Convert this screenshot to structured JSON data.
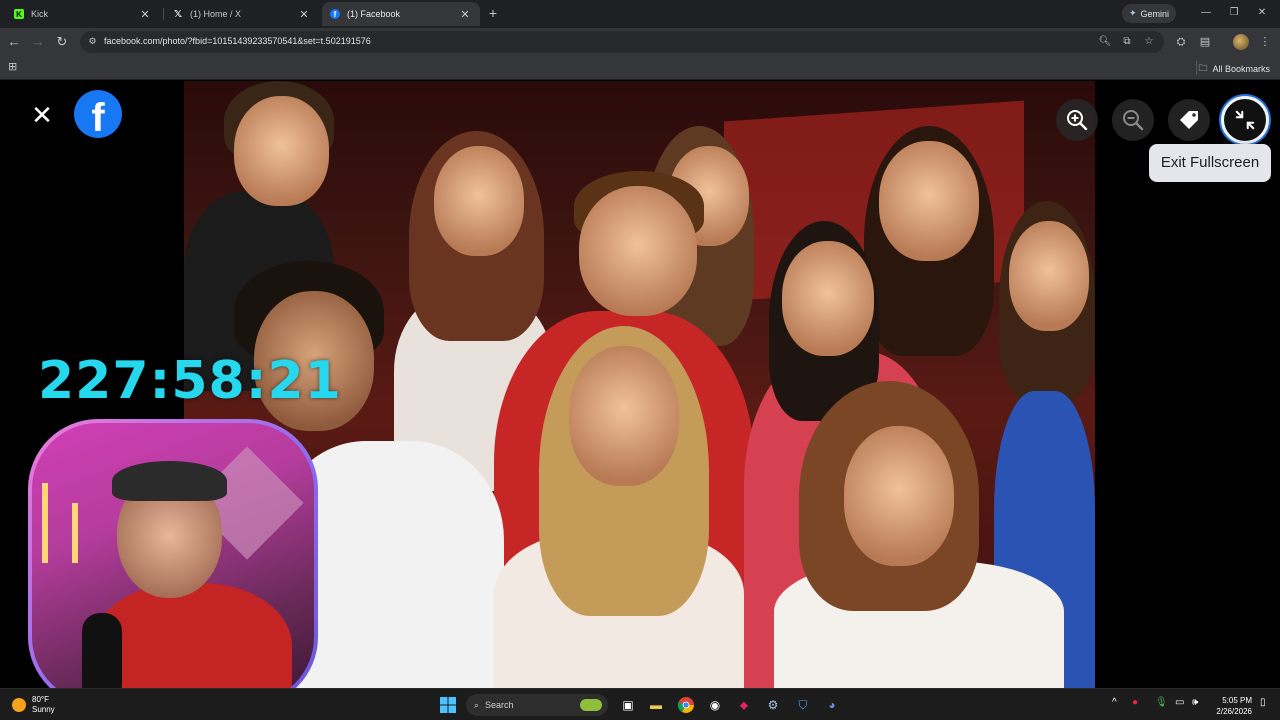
{
  "browser": {
    "tabs": [
      {
        "title": "Kick",
        "favicon": "kick-icon"
      },
      {
        "title": "(1) Home / X",
        "favicon": "x-icon"
      },
      {
        "title": "(1) Facebook",
        "favicon": "facebook-icon"
      }
    ],
    "gemini_label": "Gemini",
    "url": "facebook.com/photo/?fbid=10151439233570541&set=t.502191576",
    "bookmarks_label": "All Bookmarks"
  },
  "viewer": {
    "tooltip": "Exit Fullscreen",
    "buttons": [
      "zoom-in-icon",
      "zoom-out-icon",
      "tag-icon",
      "exit-fullscreen-icon"
    ]
  },
  "overlay": {
    "timer": "227:58:21"
  },
  "taskbar": {
    "temperature": "80°F",
    "condition": "Sunny",
    "search_placeholder": "Search",
    "time": "5:05 PM",
    "date": "2/26/2026"
  },
  "colors": {
    "facebook_blue": "#1877f2",
    "timer_cyan": "#25d8ee",
    "focus_ring": "#2374e1"
  }
}
